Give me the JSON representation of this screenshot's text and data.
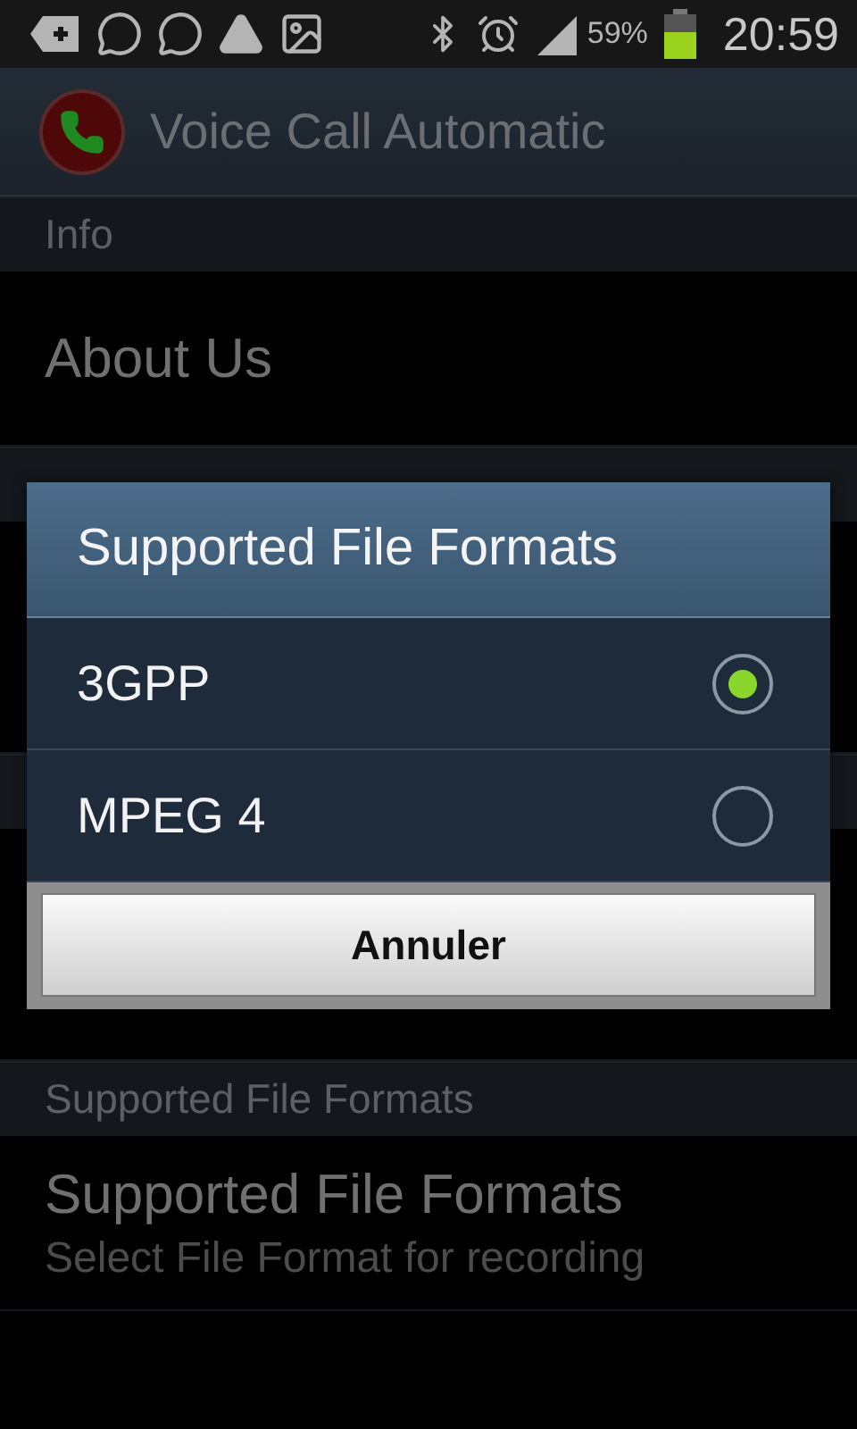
{
  "status_bar": {
    "battery": "59%",
    "time": "20:59"
  },
  "action_bar": {
    "title": "Voice Call Automatic"
  },
  "preferences": [
    {
      "kind": "header",
      "title": "Info"
    },
    {
      "kind": "item",
      "title": "About Us"
    },
    {
      "kind": "header"
    },
    {
      "kind": "item"
    },
    {
      "kind": "header"
    },
    {
      "kind": "item"
    },
    {
      "kind": "header",
      "title": "Supported File Formats"
    },
    {
      "kind": "item",
      "title": "Supported File Formats",
      "summary": "Select File Format for recording"
    }
  ],
  "dialog": {
    "title": "Supported File Formats",
    "options": [
      {
        "label": "3GPP",
        "selected": true
      },
      {
        "label": "MPEG 4",
        "selected": false
      }
    ],
    "cancel": "Annuler"
  }
}
